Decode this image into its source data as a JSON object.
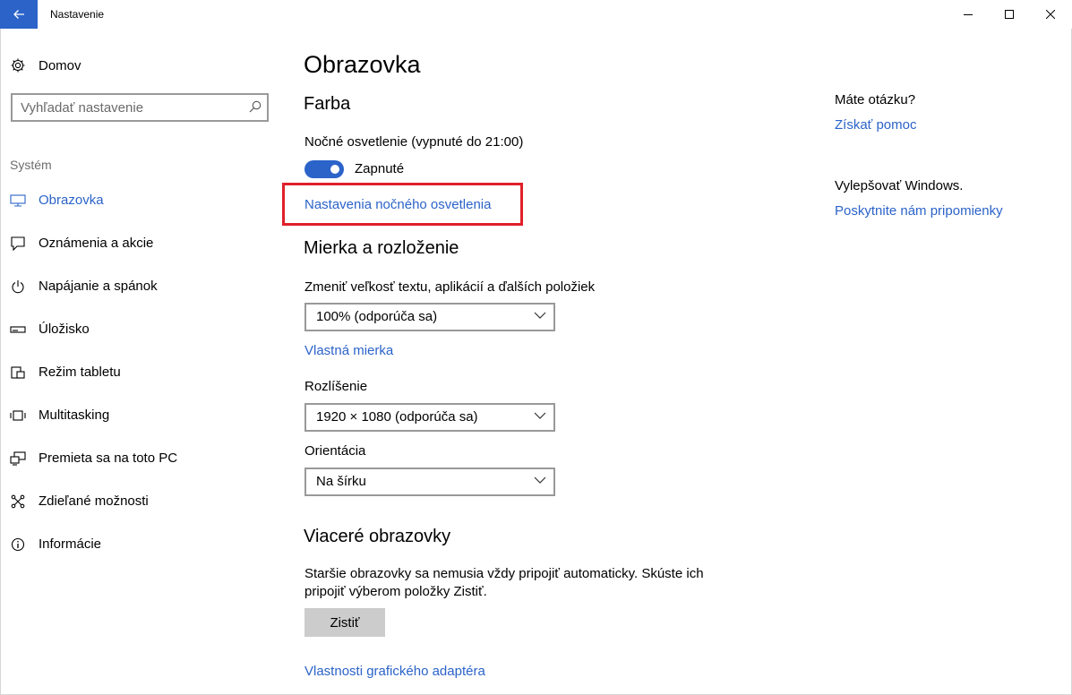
{
  "window": {
    "title": "Nastavenie",
    "back_icon": "arrow-left-icon",
    "controls": [
      "minimize-icon",
      "maximize-icon",
      "close-icon"
    ]
  },
  "sidebar": {
    "home_label": "Domov",
    "home_icon": "gear-icon",
    "search_placeholder": "Vyhľadať nastavenie",
    "section_label": "Systém",
    "items": [
      {
        "label": "Obrazovka",
        "icon": "monitor-icon",
        "active": true
      },
      {
        "label": "Oznámenia a akcie",
        "icon": "notification-icon"
      },
      {
        "label": "Napájanie a spánok",
        "icon": "power-icon"
      },
      {
        "label": "Úložisko",
        "icon": "storage-icon"
      },
      {
        "label": "Režim tabletu",
        "icon": "tablet-icon"
      },
      {
        "label": "Multitasking",
        "icon": "multitasking-icon"
      },
      {
        "label": "Premieta sa na toto PC",
        "icon": "projecting-icon"
      },
      {
        "label": "Zdieľané možnosti",
        "icon": "shared-icon"
      },
      {
        "label": "Informácie",
        "icon": "info-icon"
      }
    ]
  },
  "main": {
    "page_title": "Obrazovka",
    "color": {
      "heading": "Farba",
      "night_light_label": "Nočné osvetlenie (vypnuté do 21:00)",
      "toggle_state": "Zapnuté",
      "night_light_settings_link": "Nastavenia nočného osvetlenia"
    },
    "scale": {
      "heading": "Mierka a rozloženie",
      "size_label": "Zmeniť veľkosť textu, aplikácií a ďalších položiek",
      "size_value": "100% (odporúča sa)",
      "custom_scale_link": "Vlastná mierka",
      "resolution_label": "Rozlíšenie",
      "resolution_value": "1920 × 1080 (odporúča sa)",
      "orientation_label": "Orientácia",
      "orientation_value": "Na šírku"
    },
    "multiple": {
      "heading": "Viaceré obrazovky",
      "description": "Staršie obrazovky sa nemusia vždy pripojiť automaticky. Skúste ich pripojiť výberom položky Zistiť.",
      "detect_button": "Zistiť",
      "adapter_link": "Vlastnosti grafického adaptéra"
    }
  },
  "help": {
    "question": "Máte otázku?",
    "get_help_link": "Získať pomoc",
    "improve": "Vylepšovať Windows.",
    "feedback_link": "Poskytnite nám pripomienky"
  },
  "colors": {
    "accent": "#2b63c9",
    "highlight": "#e0202a",
    "button": "#cccccc"
  }
}
